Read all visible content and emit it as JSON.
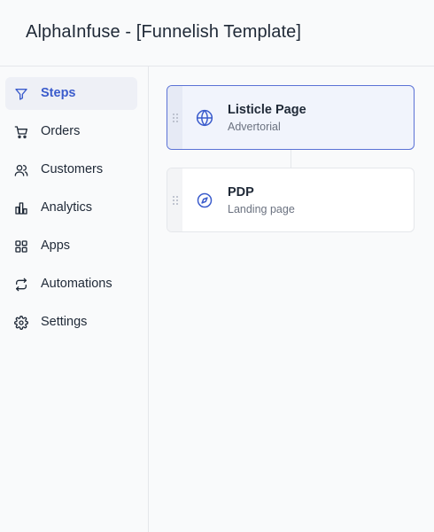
{
  "header": {
    "title": "AlphaInfuse - [Funnelish Template]"
  },
  "sidebar": {
    "items": [
      {
        "label": "Steps",
        "icon": "filter-icon",
        "active": true
      },
      {
        "label": "Orders",
        "icon": "cart-icon",
        "active": false
      },
      {
        "label": "Customers",
        "icon": "users-icon",
        "active": false
      },
      {
        "label": "Analytics",
        "icon": "bar-chart-icon",
        "active": false
      },
      {
        "label": "Apps",
        "icon": "grid-icon",
        "active": false
      },
      {
        "label": "Automations",
        "icon": "repeat-icon",
        "active": false
      },
      {
        "label": "Settings",
        "icon": "gear-icon",
        "active": false
      }
    ]
  },
  "steps": [
    {
      "title": "Listicle Page",
      "subtitle": "Advertorial",
      "icon": "globe-icon",
      "selected": true
    },
    {
      "title": "PDP",
      "subtitle": "Landing page",
      "icon": "compass-icon",
      "selected": false
    }
  ],
  "colors": {
    "accent": "#3b5ccc",
    "selected_border": "#5b72d6",
    "text": "#1f2937",
    "muted": "#6b7280"
  }
}
